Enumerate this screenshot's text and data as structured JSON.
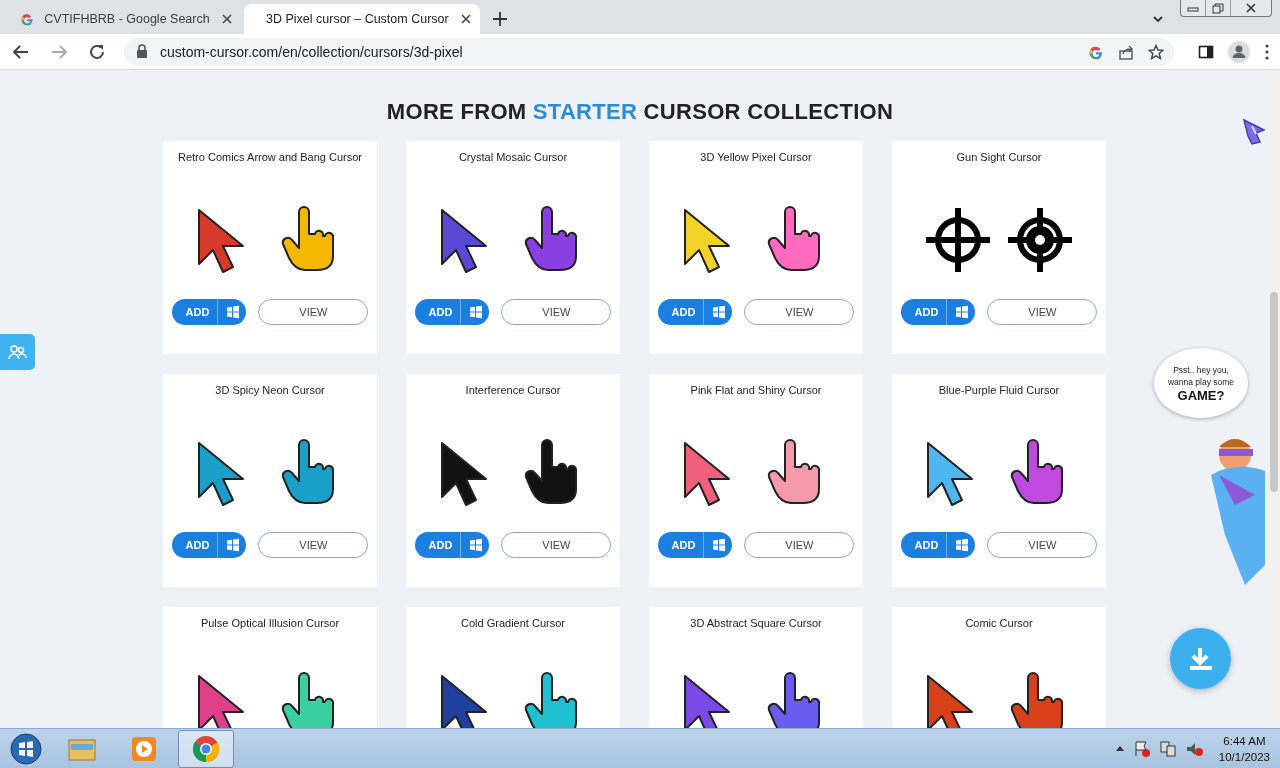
{
  "browser": {
    "tabs": [
      {
        "title": "CVTIFHBRB - Google Search",
        "selected": false,
        "kind": "google"
      },
      {
        "title": "3D Pixel cursor – Custom Cursor",
        "selected": true,
        "kind": "cursor"
      }
    ],
    "address": "custom-cursor.com/en/collection/cursors/3d-pixel"
  },
  "page": {
    "heading": [
      {
        "text": "MORE FROM ",
        "kind": "plain"
      },
      {
        "text": "STARTER",
        "kind": "accent"
      },
      {
        "text": " CURSOR COLLECTION",
        "kind": "plain"
      }
    ],
    "cards": [
      {
        "title": "Retro Comics Arrow and Bang Cursor",
        "add": "ADD",
        "view": "VIEW"
      },
      {
        "title": "Crystal Mosaic Cursor",
        "add": "ADD",
        "view": "VIEW"
      },
      {
        "title": "3D Yellow Pixel Cursor",
        "add": "ADD",
        "view": "VIEW"
      },
      {
        "title": "Gun Sight Cursor",
        "add": "ADD",
        "view": "VIEW"
      },
      {
        "title": "3D Spicy Neon Cursor",
        "add": "ADD",
        "view": "VIEW"
      },
      {
        "title": "Interference Cursor",
        "add": "ADD",
        "view": "VIEW"
      },
      {
        "title": "Pink Flat and Shiny Cursor",
        "add": "ADD",
        "view": "VIEW"
      },
      {
        "title": "Blue-Purple Fluid Cursor",
        "add": "ADD",
        "view": "VIEW"
      },
      {
        "title": "Pulse Optical Illusion Cursor"
      },
      {
        "title": "Cold Gradient Cursor"
      },
      {
        "title": "3D Abstract Square Cursor"
      },
      {
        "title": "Comic Cursor"
      }
    ],
    "bubble": {
      "lines": [
        "Psst.. hey you,",
        "wanna play some"
      ],
      "shout": "GAME?"
    }
  },
  "taskbar": {
    "apps": [
      {
        "kind": "explorer",
        "selected": false
      },
      {
        "kind": "media",
        "selected": false
      },
      {
        "kind": "chrome",
        "selected": true
      }
    ],
    "time": "6:44 AM",
    "date": "10/1/2023"
  }
}
